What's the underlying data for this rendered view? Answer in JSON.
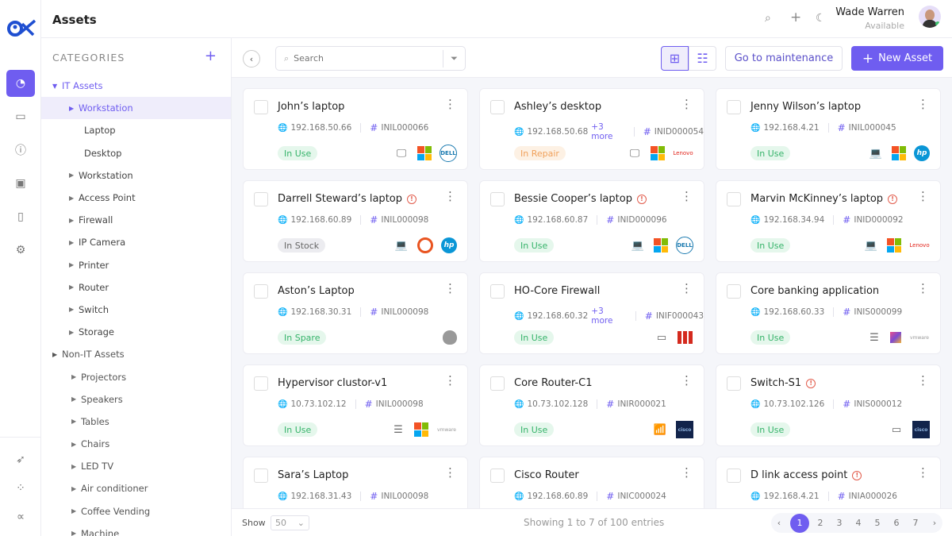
{
  "header": {
    "title": "Assets",
    "user_name": "Wade Warren",
    "user_status": "Available"
  },
  "colors": {
    "accent": "#6f5df0",
    "in_use": "#36b36a",
    "in_repair": "#f0a05a",
    "alert": "#e25b4b"
  },
  "categories": {
    "heading": "CATEGORIES",
    "items": [
      {
        "label": "IT Assets",
        "level": 0,
        "expanded": true
      },
      {
        "label": "Workstation",
        "level": 1,
        "selected": true
      },
      {
        "label": "Laptop",
        "level": 2
      },
      {
        "label": "Desktop",
        "level": 2
      },
      {
        "label": "Workstation",
        "level": 1
      },
      {
        "label": "Access Point",
        "level": 1
      },
      {
        "label": "Firewall",
        "level": 1
      },
      {
        "label": "IP Camera",
        "level": 1
      },
      {
        "label": "Printer",
        "level": 1
      },
      {
        "label": "Router",
        "level": 1
      },
      {
        "label": "Switch",
        "level": 1
      },
      {
        "label": "Storage",
        "level": 1
      },
      {
        "label": "Non-IT Assets",
        "level": 0
      },
      {
        "label": "Projectors",
        "level": 1
      },
      {
        "label": "Speakers",
        "level": 1
      },
      {
        "label": "Tables",
        "level": 1
      },
      {
        "label": "Chairs",
        "level": 1
      },
      {
        "label": "LED TV",
        "level": 1
      },
      {
        "label": "Air conditioner",
        "level": 1
      },
      {
        "label": "Coffee Vending",
        "level": 1
      },
      {
        "label": "Machine",
        "level": 1
      }
    ]
  },
  "toolbar": {
    "search_placeholder": "Search",
    "maintenance_label": "Go to maintenance",
    "new_asset_label": "New Asset",
    "view": "grid"
  },
  "assets": [
    {
      "name": "John’s laptop",
      "alert": false,
      "ip": "192.168.50.66",
      "more": "",
      "id": "INIL000066",
      "status": "In Use",
      "device": "desktop",
      "os": "windows",
      "brand": "dell"
    },
    {
      "name": "Ashley’s desktop",
      "alert": false,
      "ip": "192.168.50.68",
      "more": "+3 more",
      "id": "INID000054",
      "status": "In Repair",
      "device": "desktop",
      "os": "windows",
      "brand": "lenovo"
    },
    {
      "name": "Jenny Wilson’s laptop",
      "alert": false,
      "ip": "192.168.4.21",
      "more": "",
      "id": "INIL000045",
      "status": "In Use",
      "device": "laptop",
      "os": "windows",
      "brand": "hp"
    },
    {
      "name": "Darrell Steward’s laptop",
      "alert": true,
      "ip": "192.168.60.89",
      "more": "",
      "id": "INIL000098",
      "status": "In Stock",
      "device": "laptop",
      "os": "ubuntu",
      "brand": "hp"
    },
    {
      "name": "Bessie Cooper’s laptop",
      "alert": true,
      "ip": "192.168.60.87",
      "more": "",
      "id": "INID000096",
      "status": "In Use",
      "device": "laptop",
      "os": "windows",
      "brand": "dell"
    },
    {
      "name": "Marvin McKinney’s laptop",
      "alert": true,
      "ip": "192.168.34.94",
      "more": "",
      "id": "INID000092",
      "status": "In Use",
      "device": "laptop",
      "os": "windows",
      "brand": "lenovo"
    },
    {
      "name": "Aston’s Laptop",
      "alert": false,
      "ip": "192.168.30.31",
      "more": "",
      "id": "INIL000098",
      "status": "In Spare",
      "device": "",
      "os": "",
      "brand": "apple"
    },
    {
      "name": "HO-Core Firewall",
      "alert": false,
      "ip": "192.168.60.32",
      "more": "+3 more",
      "id": "INIF000043",
      "status": "In Use",
      "device": "firewall",
      "os": "",
      "brand": "fortinet"
    },
    {
      "name": "Core banking application",
      "alert": false,
      "ip": "192.168.60.33",
      "more": "",
      "id": "INIS000099",
      "status": "In Use",
      "device": "server",
      "os": "suse",
      "brand": "vmware"
    },
    {
      "name": "Hypervisor clustor-v1",
      "alert": false,
      "ip": "10.73.102.12",
      "more": "",
      "id": "INIL000098",
      "status": "In Use",
      "device": "server",
      "os": "windows",
      "brand": "vmware"
    },
    {
      "name": "Core Router-C1",
      "alert": false,
      "ip": "10.73.102.128",
      "more": "",
      "id": "INIR000021",
      "status": "In Use",
      "device": "router",
      "os": "",
      "brand": "cisco"
    },
    {
      "name": "Switch-S1",
      "alert": true,
      "ip": "10.73.102.126",
      "more": "",
      "id": "INIS000012",
      "status": "In Use",
      "device": "switch",
      "os": "",
      "brand": "cisco"
    },
    {
      "name": "Sara’s Laptop",
      "alert": false,
      "ip": "192.168.31.43",
      "more": "",
      "id": "INIL000098",
      "status": "",
      "device": "",
      "os": "",
      "brand": ""
    },
    {
      "name": "Cisco Router",
      "alert": false,
      "ip": "192.168.60.89",
      "more": "",
      "id": "INIC000024",
      "status": "",
      "device": "",
      "os": "",
      "brand": ""
    },
    {
      "name": "D link access point",
      "alert": true,
      "ip": "192.168.4.21",
      "more": "",
      "id": "INIA000026",
      "status": "",
      "device": "",
      "os": "",
      "brand": ""
    }
  ],
  "footer": {
    "show_label": "Show",
    "page_size": "50",
    "info": "Showing 1 to 7 of 100 entries",
    "pages": [
      "1",
      "2",
      "3",
      "4",
      "5",
      "6",
      "7"
    ],
    "current_page": "1"
  }
}
